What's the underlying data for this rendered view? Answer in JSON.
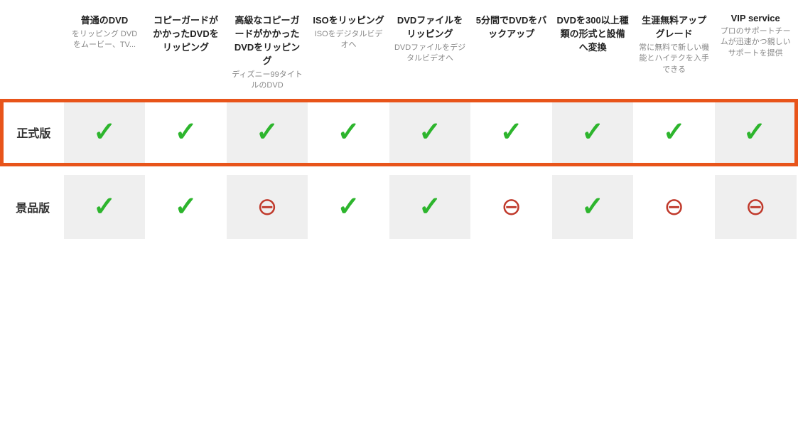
{
  "columns": [
    {
      "id": "col-normal-dvd",
      "title": "普通のDVD",
      "subtitle": "をリッピング DVDをムービー、TV..."
    },
    {
      "id": "col-copy-guard",
      "title": "コピーガードがかかったDVDをリッピング",
      "subtitle": ""
    },
    {
      "id": "col-advanced-copy",
      "title": "高級なコピーガードがかかったDVDをリッピング",
      "subtitle": "ディズニー99タイトルのDVD"
    },
    {
      "id": "col-iso",
      "title": "ISOをリッピング",
      "subtitle": "ISOをデジタルビデオへ"
    },
    {
      "id": "col-dvd-file",
      "title": "DVDファイルをリッピング",
      "subtitle": "DVDファイルをデジタルビデオへ"
    },
    {
      "id": "col-5min",
      "title": "5分間でDVDをバックアップ",
      "subtitle": ""
    },
    {
      "id": "col-300",
      "title": "DVDを300以上種類の形式と設備へ変換",
      "subtitle": ""
    },
    {
      "id": "col-upgrade",
      "title": "生涯無料アップグレード",
      "subtitle": "常に無料で新しい機能とハイテクを入手できる"
    },
    {
      "id": "col-vip",
      "title": "VIP service",
      "subtitle": "プロのサポートチームが迅速かつ親しいサポートを提供"
    }
  ],
  "rows": [
    {
      "id": "row-official",
      "label": "正式版",
      "highlighted": true,
      "cells": [
        true,
        true,
        true,
        true,
        true,
        true,
        true,
        true,
        true
      ]
    },
    {
      "id": "row-free",
      "label": "景品版",
      "highlighted": false,
      "cells": [
        true,
        true,
        false,
        true,
        true,
        false,
        true,
        false,
        false
      ]
    }
  ],
  "check_symbol": "✓",
  "minus_symbol": "⊖"
}
